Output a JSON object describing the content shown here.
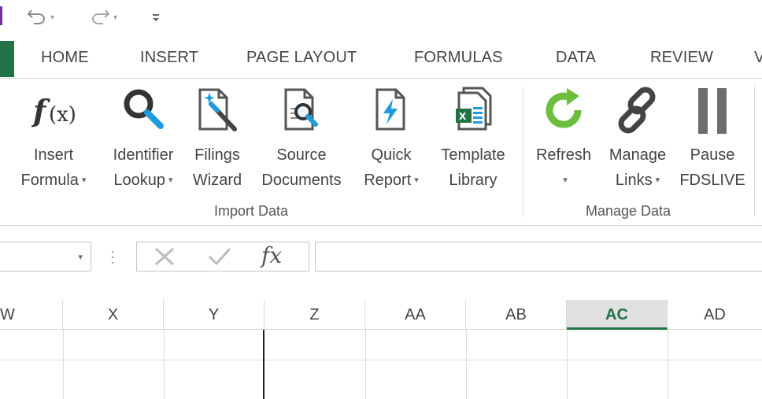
{
  "qat": {
    "undo_icon": "undo-icon",
    "redo_icon": "redo-icon",
    "customize_icon": "customize-qat-icon"
  },
  "tabs": [
    "HOME",
    "INSERT",
    "PAGE LAYOUT",
    "FORMULAS",
    "DATA",
    "REVIEW",
    "V"
  ],
  "ribbon": {
    "groups": [
      {
        "label": "Import Data"
      },
      {
        "label": "Manage Data"
      }
    ],
    "buttons": [
      {
        "line1": "Insert",
        "line2": "Formula",
        "dropdown": true,
        "icon": "function-icon"
      },
      {
        "line1": "Identifier",
        "line2": "Lookup",
        "dropdown": true,
        "icon": "magnifier-icon"
      },
      {
        "line1": "Filings",
        "line2": "Wizard",
        "dropdown": false,
        "icon": "filings-wizard-icon"
      },
      {
        "line1": "Source",
        "line2": "Documents",
        "dropdown": false,
        "icon": "source-documents-icon"
      },
      {
        "line1": "Quick",
        "line2": "Report",
        "dropdown": true,
        "icon": "quick-report-icon"
      },
      {
        "line1": "Template",
        "line2": "Library",
        "dropdown": false,
        "icon": "template-library-icon"
      },
      {
        "line1": "Refresh",
        "line2": "",
        "dropdown": true,
        "icon": "refresh-icon"
      },
      {
        "line1": "Manage",
        "line2": "Links",
        "dropdown": true,
        "icon": "link-icon"
      },
      {
        "line1": "Pause",
        "line2": "FDSLIVE",
        "dropdown": false,
        "icon": "pause-icon"
      }
    ],
    "dropdown_glyph": "▾"
  },
  "formula_bar": {
    "name_value": "",
    "formula_value": "",
    "fx_label": "fx"
  },
  "columns": [
    "W",
    "X",
    "Y",
    "Z",
    "AA",
    "AB",
    "AC",
    "AD"
  ],
  "selected_column": "AC",
  "colors": {
    "excel_green": "#217346",
    "refresh_green": "#6dbe3f",
    "accent_blue": "#1f9bde",
    "pause_gray": "#6d6d6d"
  }
}
